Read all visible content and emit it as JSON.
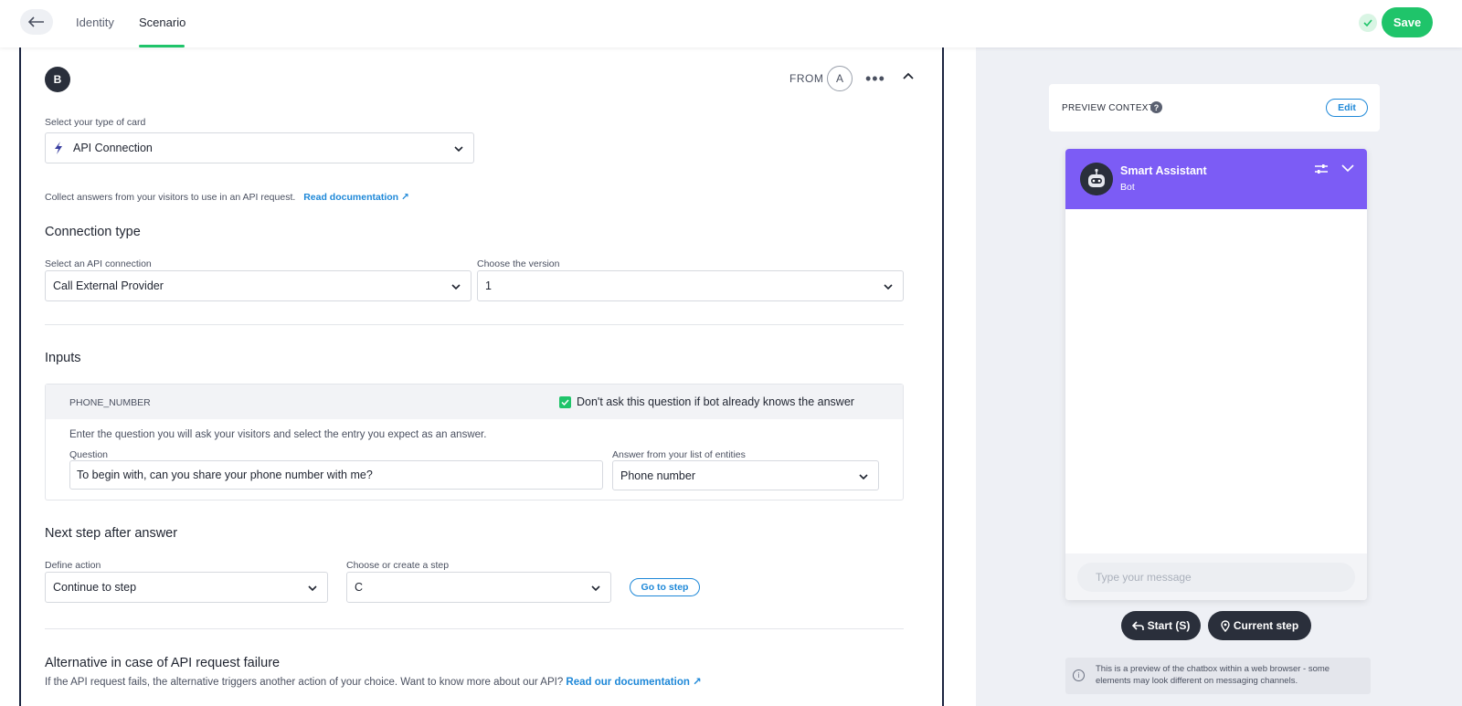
{
  "header": {
    "back_icon": "arrow-left-icon",
    "tabs": [
      {
        "label": "Identity"
      },
      {
        "label": "Scenario",
        "active": true
      }
    ],
    "save_label": "Save",
    "accent": "#1fc46a"
  },
  "step": {
    "badge": "B",
    "from_label": "FROM",
    "from_step": "A",
    "more_icon": "more-horizontal-icon",
    "collapse_icon": "chevron-up-icon"
  },
  "card_type": {
    "label": "Select your type of card",
    "value": "API Connection",
    "icon": "lightning-icon"
  },
  "description": {
    "text": "Collect answers from your visitors to use in an API request.",
    "link": "Read documentation"
  },
  "connection": {
    "title": "Connection type",
    "api_label": "Select an API connection",
    "api_value": "Call External Provider",
    "version_label": "Choose the version",
    "version_value": "1"
  },
  "inputs": {
    "title": "Inputs",
    "variable": "PHONE_NUMBER",
    "skip_checkbox_label": "Don't ask this question if bot already knows the answer",
    "skip_checked": true,
    "instructions": "Enter the question you will ask your visitors and select the entry you expect as an answer.",
    "question_label": "Question",
    "question_value": "To begin with, can you share your phone number with me?",
    "entity_label": "Answer from your list of entities",
    "entity_value": "Phone number"
  },
  "next_step": {
    "title": "Next step after answer",
    "action_label": "Define action",
    "action_value": "Continue to step",
    "step_label": "Choose or create a step",
    "step_value": "C",
    "go_button": "Go to step"
  },
  "fallback": {
    "title": "Alternative in case of API request failure",
    "text": "If the API request fails, the alternative triggers another action of your choice. Want to know more about our API?",
    "link": "Read our documentation"
  },
  "preview": {
    "context_label": "PREVIEW CONTEXT",
    "edit_label": "Edit",
    "bot_name": "Smart Assistant",
    "bot_role": "Bot",
    "header_color": "#7c5cf5",
    "input_placeholder": "Type your message",
    "start_button": "Start (S)",
    "current_button": "Current step",
    "note": "This is a preview of the chatbox within a web browser - some elements may look different on messaging channels."
  }
}
